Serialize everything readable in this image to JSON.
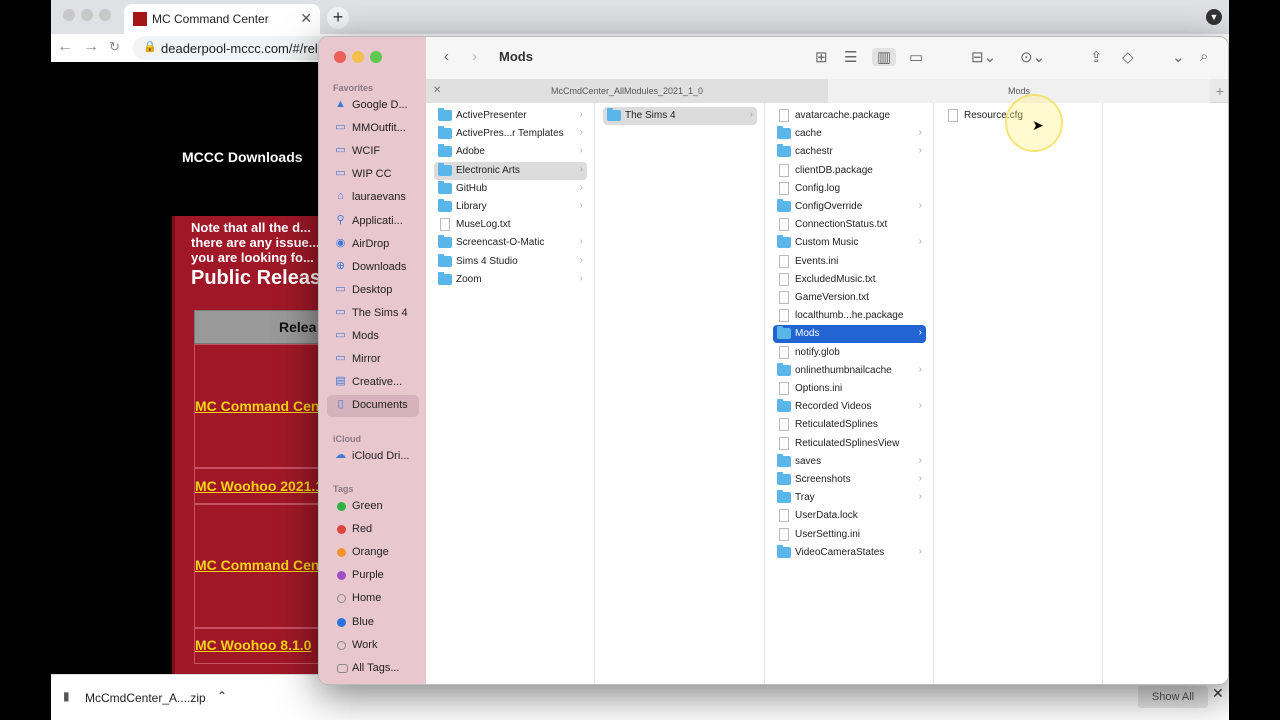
{
  "browser": {
    "tab_title": "MC Command Center",
    "url": "deaderpool-mccc.com/#/rele",
    "new_tab_label": "+"
  },
  "webpage": {
    "mccc_downloads": "MCCC Downloads",
    "note_text": "Note that all the d... there are any issue... you are looking fo...",
    "public_releases": "Public Releas",
    "table_header": "Relea",
    "links": [
      "MC Command Cen",
      "MC Woohoo 2021.1",
      "MC Command Cen",
      "MC Woohoo 8.1.0"
    ]
  },
  "downloads_bar": {
    "file_name": "McCmdCenter_A....zip",
    "show_all": "Show All"
  },
  "finder": {
    "title": "Mods",
    "path_segments": [
      "McCmdCenter_AllModules_2021_1_0",
      "Mods"
    ],
    "sidebar": {
      "favorites_header": "Favorites",
      "favorites": [
        {
          "label": "Google D...",
          "icon": "drive-icon"
        },
        {
          "label": "MMOutfit...",
          "icon": "folder-icon"
        },
        {
          "label": "WCIF",
          "icon": "folder-icon"
        },
        {
          "label": "WIP CC",
          "icon": "folder-icon"
        },
        {
          "label": "lauraevans",
          "icon": "home-icon"
        },
        {
          "label": "Applicati...",
          "icon": "applications-icon"
        },
        {
          "label": "AirDrop",
          "icon": "airdrop-icon"
        },
        {
          "label": "Downloads",
          "icon": "download-icon"
        },
        {
          "label": "Desktop",
          "icon": "desktop-icon"
        },
        {
          "label": "The Sims 4",
          "icon": "folder-icon"
        },
        {
          "label": "Mods",
          "icon": "folder-icon"
        },
        {
          "label": "Mirror",
          "icon": "folder-icon"
        },
        {
          "label": "Creative...",
          "icon": "creative-cloud-icon"
        },
        {
          "label": "Documents",
          "icon": "document-icon"
        }
      ],
      "icloud_header": "iCloud",
      "icloud": [
        {
          "label": "iCloud Dri...",
          "icon": "cloud-icon"
        }
      ],
      "tags_header": "Tags",
      "tags": [
        {
          "label": "Green",
          "color": "#2fb344"
        },
        {
          "label": "Red",
          "color": "#e0443e"
        },
        {
          "label": "Orange",
          "color": "#f3912c"
        },
        {
          "label": "Purple",
          "color": "#a04ec7"
        },
        {
          "label": "Home",
          "color": "#ffffff"
        },
        {
          "label": "Blue",
          "color": "#2c73e0"
        },
        {
          "label": "Work",
          "color": "#ffffff"
        },
        {
          "label": "All Tags...",
          "color": "none"
        }
      ]
    },
    "columns": [
      [
        {
          "name": "ActivePresenter",
          "type": "folder"
        },
        {
          "name": "ActivePres...r Templates",
          "type": "folder"
        },
        {
          "name": "Adobe",
          "type": "folder"
        },
        {
          "name": "Electronic Arts",
          "type": "folder"
        },
        {
          "name": "GitHub",
          "type": "folder"
        },
        {
          "name": "Library",
          "type": "folder"
        },
        {
          "name": "MuseLog.txt",
          "type": "file"
        },
        {
          "name": "Screencast-O-Matic",
          "type": "folder"
        },
        {
          "name": "Sims 4 Studio",
          "type": "folder"
        },
        {
          "name": "Zoom",
          "type": "folder"
        }
      ],
      [
        {
          "name": "The Sims 4",
          "type": "folder"
        }
      ],
      [
        {
          "name": "avatarcache.package",
          "type": "file"
        },
        {
          "name": "cache",
          "type": "folder"
        },
        {
          "name": "cachestr",
          "type": "folder"
        },
        {
          "name": "clientDB.package",
          "type": "file"
        },
        {
          "name": "Config.log",
          "type": "file"
        },
        {
          "name": "ConfigOverride",
          "type": "folder"
        },
        {
          "name": "ConnectionStatus.txt",
          "type": "file"
        },
        {
          "name": "Custom Music",
          "type": "folder"
        },
        {
          "name": "Events.ini",
          "type": "file"
        },
        {
          "name": "ExcludedMusic.txt",
          "type": "file"
        },
        {
          "name": "GameVersion.txt",
          "type": "file"
        },
        {
          "name": "localthumb...he.package",
          "type": "file"
        },
        {
          "name": "Mods",
          "type": "folder"
        },
        {
          "name": "notify.glob",
          "type": "file"
        },
        {
          "name": "onlinethumbnailcache",
          "type": "folder"
        },
        {
          "name": "Options.ini",
          "type": "file"
        },
        {
          "name": "Recorded Videos",
          "type": "folder"
        },
        {
          "name": "ReticulatedSplines",
          "type": "file"
        },
        {
          "name": "ReticulatedSplinesView",
          "type": "file"
        },
        {
          "name": "saves",
          "type": "folder"
        },
        {
          "name": "Screenshots",
          "type": "folder"
        },
        {
          "name": "Tray",
          "type": "folder"
        },
        {
          "name": "UserData.lock",
          "type": "file"
        },
        {
          "name": "UserSetting.ini",
          "type": "file"
        },
        {
          "name": "VideoCameraStates",
          "type": "folder"
        }
      ],
      [
        {
          "name": "Resource.cfg",
          "type": "file"
        }
      ]
    ]
  }
}
